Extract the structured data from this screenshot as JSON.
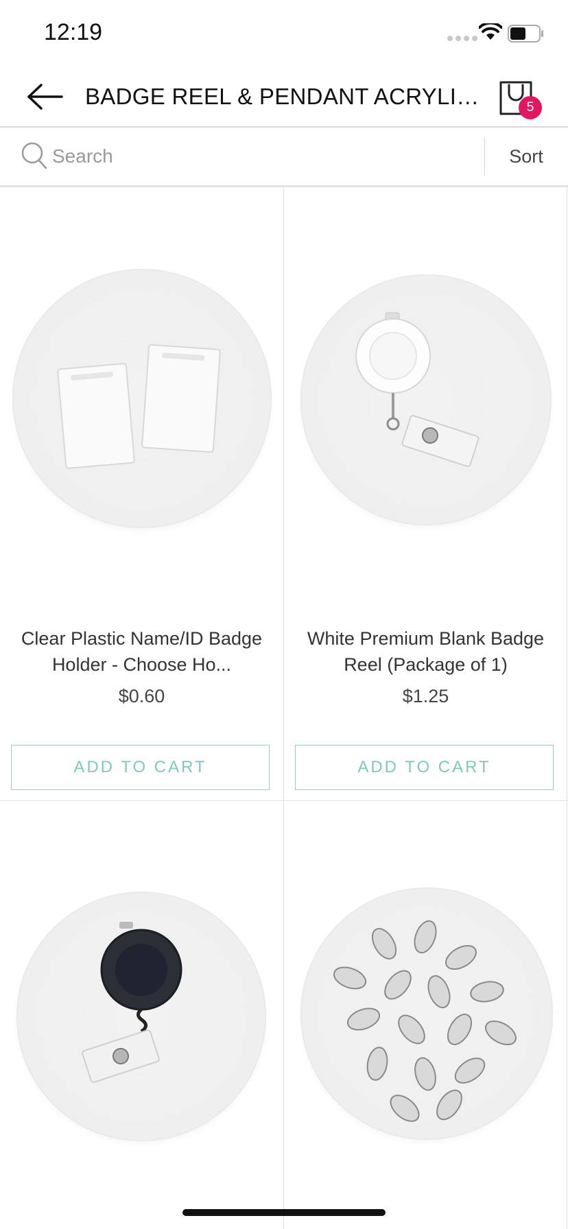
{
  "status_bar": {
    "time": "12:19"
  },
  "nav": {
    "title": "BADGE REEL & PENDANT ACRYLIC A...",
    "cart_count": "5"
  },
  "search": {
    "placeholder": "Search",
    "sort_label": "Sort"
  },
  "products": [
    {
      "title": "Clear Plastic Name/ID Badge Holder - Choose Ho...",
      "price": "$0.60",
      "button": "ADD TO CART"
    },
    {
      "title": "White Premium Blank Badge Reel (Package of 1)",
      "price": "$1.25",
      "button": "ADD TO CART"
    },
    {
      "title": "",
      "price": "",
      "button": ""
    },
    {
      "title": "",
      "price": "",
      "button": ""
    }
  ],
  "colors": {
    "accent": "#7ccabd",
    "badge": "#e2165e"
  }
}
